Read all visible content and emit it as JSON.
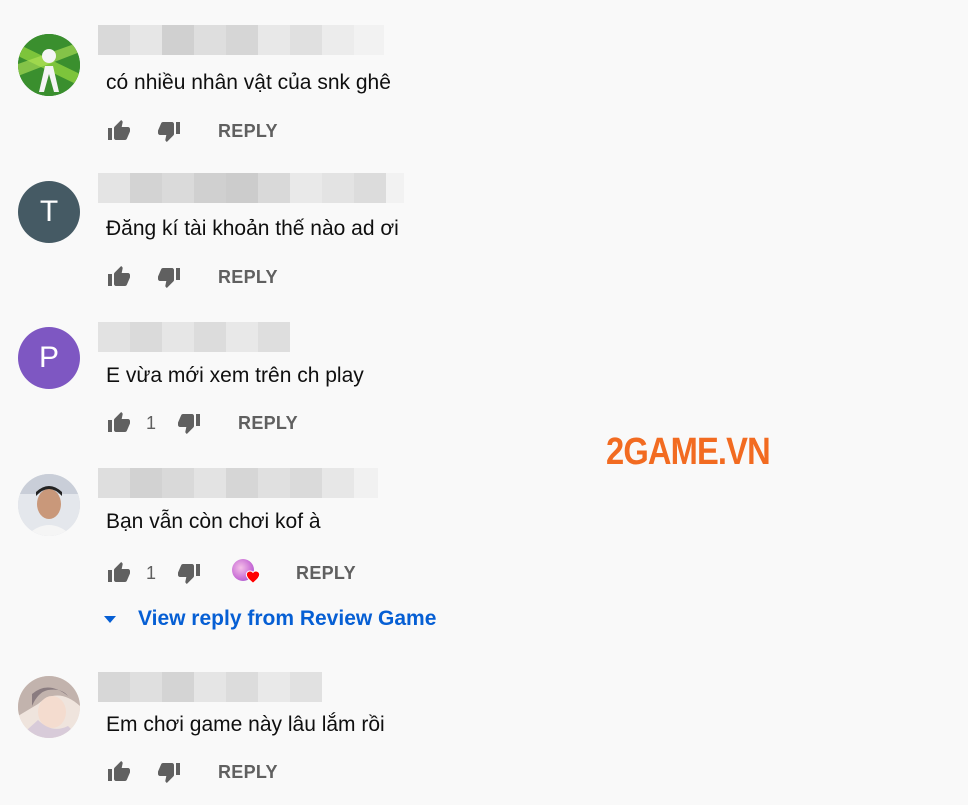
{
  "brand": {
    "watermark": "2GAME.VN",
    "watermark_color": "#f26b21",
    "link_color": "#065fd4"
  },
  "comments": [
    {
      "avatar_type": "image",
      "avatar_desc": "green-figure",
      "text": "có nhiều nhân vật của snk ghê",
      "likes": "",
      "reply_label": "REPLY"
    },
    {
      "avatar_type": "letter",
      "avatar_letter": "T",
      "avatar_color": "#455a64",
      "text": "Đăng kí tài khoản thế nào ad ơi",
      "likes": "",
      "reply_label": "REPLY"
    },
    {
      "avatar_type": "letter",
      "avatar_letter": "P",
      "avatar_color": "#7e57c2",
      "text": "E vừa mới xem trên ch play",
      "likes": "1",
      "reply_label": "REPLY"
    },
    {
      "avatar_type": "image",
      "avatar_desc": "person-photo",
      "text": "Bạn vẫn còn chơi kof à",
      "likes": "1",
      "reply_label": "REPLY",
      "creator_heart": true,
      "view_replies": "View reply from Review Game"
    },
    {
      "avatar_type": "image",
      "avatar_desc": "anime-girl",
      "text": "Em chơi game này lâu lắm rồi",
      "likes": "",
      "reply_label": "REPLY"
    }
  ]
}
